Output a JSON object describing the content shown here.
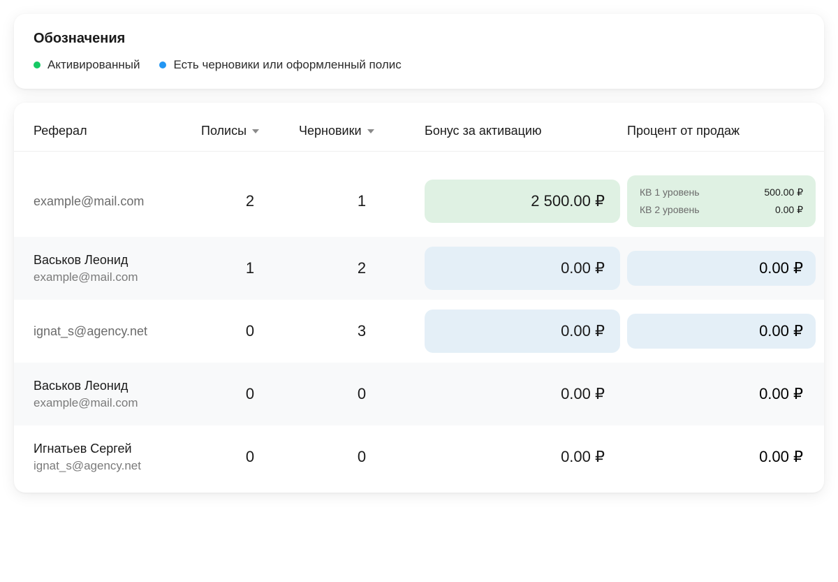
{
  "legend": {
    "title": "Обозначения",
    "items": [
      {
        "color": "green",
        "label": "Активированный"
      },
      {
        "color": "blue",
        "label": "Есть черновики или оформленный полис"
      }
    ]
  },
  "table": {
    "headers": {
      "referral": "Реферал",
      "policies": "Полисы",
      "drafts": "Черновики",
      "bonus": "Бонус за активацию",
      "percent": "Процент от продаж"
    },
    "rows": [
      {
        "name": "",
        "email": "example@mail.com",
        "policies": "2",
        "drafts": "1",
        "bonus": "2 500.00 ₽",
        "bonus_style": "green",
        "percent_style": "green",
        "percent_simple": "",
        "kv1_label": "КВ 1 уровень",
        "kv1_value": "500.00 ₽",
        "kv2_label": "КВ 2 уровень",
        "kv2_value": "0.00 ₽",
        "zebra": false
      },
      {
        "name": "Васьков Леонид",
        "email": "example@mail.com",
        "policies": "1",
        "drafts": "2",
        "bonus": "0.00 ₽",
        "bonus_style": "blue",
        "percent_style": "blue",
        "percent_simple": "0.00 ₽",
        "zebra": true
      },
      {
        "name": "",
        "email": "ignat_s@agency.net",
        "policies": "0",
        "drafts": "3",
        "bonus": "0.00 ₽",
        "bonus_style": "blue",
        "percent_style": "blue",
        "percent_simple": "0.00 ₽",
        "zebra": false
      },
      {
        "name": "Васьков Леонид",
        "email": "example@mail.com",
        "policies": "0",
        "drafts": "0",
        "bonus": "0.00 ₽",
        "bonus_style": "none",
        "percent_style": "none",
        "percent_simple": "0.00 ₽",
        "zebra": true
      },
      {
        "name": "Игнатьев Сергей",
        "email": "ignat_s@agency.net",
        "policies": "0",
        "drafts": "0",
        "bonus": "0.00 ₽",
        "bonus_style": "none",
        "percent_style": "none",
        "percent_simple": "0.00 ₽",
        "zebra": false
      }
    ]
  }
}
